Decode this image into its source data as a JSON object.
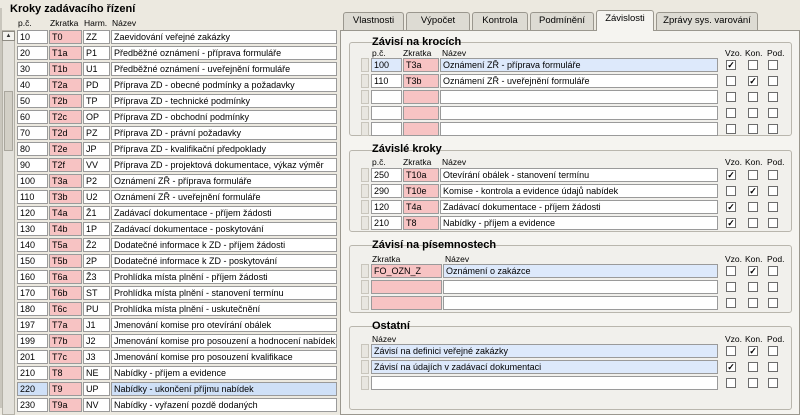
{
  "left": {
    "title": "Kroky zadávacího řízení",
    "col_pc": "p.č.",
    "col_zkratka": "Zkratka",
    "col_harm": "Harm.",
    "col_nazev": "Název",
    "rows": [
      {
        "pc": "10",
        "z": "T0",
        "h": "ZZ",
        "n": "Zaevidování veřejné zakázky"
      },
      {
        "pc": "20",
        "z": "T1a",
        "h": "P1",
        "n": "Předběžné oznámení - příprava formuláře"
      },
      {
        "pc": "30",
        "z": "T1b",
        "h": "U1",
        "n": "Předběžné oznámení - uveřejnění formuláře"
      },
      {
        "pc": "40",
        "z": "T2a",
        "h": "PD",
        "n": "Příprava ZD - obecné podmínky a požadavky"
      },
      {
        "pc": "50",
        "z": "T2b",
        "h": "TP",
        "n": "Příprava ZD - technické podmínky"
      },
      {
        "pc": "60",
        "z": "T2c",
        "h": "OP",
        "n": "Příprava ZD - obchodní podmínky"
      },
      {
        "pc": "70",
        "z": "T2d",
        "h": "PZ",
        "n": "Příprava ZD - právní požadavky"
      },
      {
        "pc": "80",
        "z": "T2e",
        "h": "JP",
        "n": "Příprava ZD - kvalifikační předpoklady"
      },
      {
        "pc": "90",
        "z": "T2f",
        "h": "VV",
        "n": "Příprava ZD - projektová dokumentace, výkaz výměr"
      },
      {
        "pc": "100",
        "z": "T3a",
        "h": "P2",
        "n": "Oznámení ZŘ - příprava formuláře"
      },
      {
        "pc": "110",
        "z": "T3b",
        "h": "U2",
        "n": "Oznámení ZŘ - uveřejnění formuláře"
      },
      {
        "pc": "120",
        "z": "T4a",
        "h": "Ž1",
        "n": "Zadávací dokumentace - příjem žádosti"
      },
      {
        "pc": "130",
        "z": "T4b",
        "h": "1P",
        "n": "Zadávací dokumentace - poskytování"
      },
      {
        "pc": "140",
        "z": "T5a",
        "h": "Ž2",
        "n": "Dodatečné informace k ZD - příjem žádosti"
      },
      {
        "pc": "150",
        "z": "T5b",
        "h": "2P",
        "n": "Dodatečné informace k ZD - poskytování"
      },
      {
        "pc": "160",
        "z": "T6a",
        "h": "Ž3",
        "n": "Prohlídka místa plnění - příjem žádosti"
      },
      {
        "pc": "170",
        "z": "T6b",
        "h": "ST",
        "n": "Prohlídka místa plnění - stanovení termínu"
      },
      {
        "pc": "180",
        "z": "T6c",
        "h": "PU",
        "n": "Prohlídka místa plnění - uskutečnění"
      },
      {
        "pc": "197",
        "z": "T7a",
        "h": "J1",
        "n": "Jmenování komise pro otevírání obálek"
      },
      {
        "pc": "199",
        "z": "T7b",
        "h": "J2",
        "n": "Jmenování komise pro posouzení a hodnocení nabídek"
      },
      {
        "pc": "201",
        "z": "T7c",
        "h": "J3",
        "n": "Jmenování komise pro posouzení kvalifikace"
      },
      {
        "pc": "210",
        "z": "T8",
        "h": "NE",
        "n": "Nabídky - příjem a evidence"
      },
      {
        "pc": "220",
        "z": "T9",
        "h": "UP",
        "n": "Nabídky - ukončení příjmu nabídek"
      },
      {
        "pc": "230",
        "z": "T9a",
        "h": "NV",
        "n": "Nabídky - vyřazení pozdě dodaných"
      }
    ]
  },
  "tabs": [
    "Vlastnosti",
    "Výpočet",
    "Kontrola",
    "Podmínění",
    "Závislosti",
    "Zprávy sys. varování"
  ],
  "g1": {
    "title": "Závisí na krocích",
    "pc": "p.č.",
    "zk": "Zkratka",
    "nz": "Název",
    "vzo": "Vzo.",
    "kon": "Kon.",
    "pod": "Pod.",
    "rows": [
      {
        "pc": "100",
        "z": "T3a",
        "n": "Oznámení ZŘ - příprava formuláře"
      },
      {
        "pc": "110",
        "z": "T3b",
        "n": "Oznámení ZŘ - uveřejnění formuláře"
      }
    ]
  },
  "g2": {
    "title": "Závislé kroky",
    "pc": "p.č.",
    "zk": "Zkratka",
    "nz": "Název",
    "vzo": "Vzo.",
    "kon": "Kon.",
    "pod": "Pod.",
    "rows": [
      {
        "pc": "250",
        "z": "T10a",
        "n": "Otevírání obálek - stanovení termínu"
      },
      {
        "pc": "290",
        "z": "T10e",
        "n": "Komise - kontrola a evidence údajů nabídek"
      },
      {
        "pc": "120",
        "z": "T4a",
        "n": "Zadávací dokumentace - příjem žádosti"
      },
      {
        "pc": "210",
        "z": "T8",
        "n": "Nabídky - příjem a evidence"
      }
    ]
  },
  "g3": {
    "title": "Závisí na písemnostech",
    "zk": "Zkratka",
    "nz": "Název",
    "vzo": "Vzo.",
    "kon": "Kon.",
    "pod": "Pod.",
    "rows": [
      {
        "z": "FO_OZN_Z",
        "n": "Oznámení o zakázce"
      }
    ]
  },
  "g4": {
    "title": "Ostatní",
    "nz": "Název",
    "vzo": "Vzo.",
    "kon": "Kon.",
    "pod": "Pod.",
    "rows": [
      {
        "n": "Závisí na definici veřejné zakázky"
      },
      {
        "n": "Závisí na údajích v zadávací dokumentaci"
      }
    ]
  }
}
